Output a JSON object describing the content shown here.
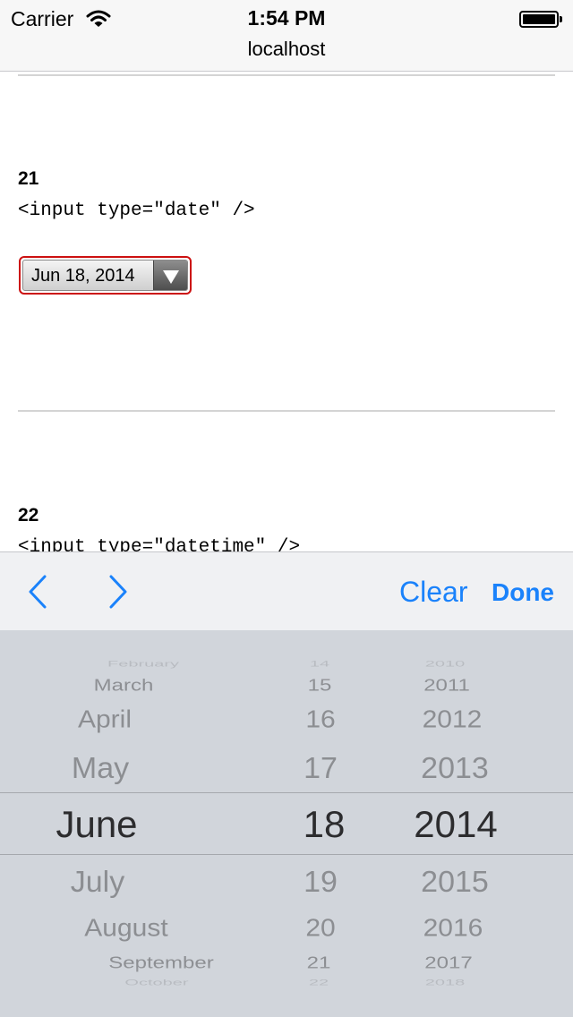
{
  "status_bar": {
    "carrier": "Carrier",
    "time": "1:54 PM"
  },
  "browser": {
    "url": "localhost"
  },
  "sections": [
    {
      "number": "21",
      "code": "<input type=\"date\" />",
      "date_value": "Jun 18, 2014"
    },
    {
      "number": "22",
      "code": "<input type=\"datetime\" />"
    }
  ],
  "toolbar": {
    "clear_label": "Clear",
    "done_label": "Done"
  },
  "picker": {
    "month": {
      "visible": [
        "February",
        "March",
        "April",
        "May",
        "June",
        "July",
        "August",
        "September",
        "October"
      ],
      "selected": "June"
    },
    "day": {
      "visible": [
        "14",
        "15",
        "16",
        "17",
        "18",
        "19",
        "20",
        "21",
        "22"
      ],
      "selected": "18"
    },
    "year": {
      "visible": [
        "2010",
        "2011",
        "2012",
        "2013",
        "2014",
        "2015",
        "2016",
        "2017",
        "2018"
      ],
      "selected": "2014"
    }
  },
  "colors": {
    "accent": "#1a82fb",
    "picker_bg": "#d1d5db",
    "focus_ring": "#cc1111"
  }
}
